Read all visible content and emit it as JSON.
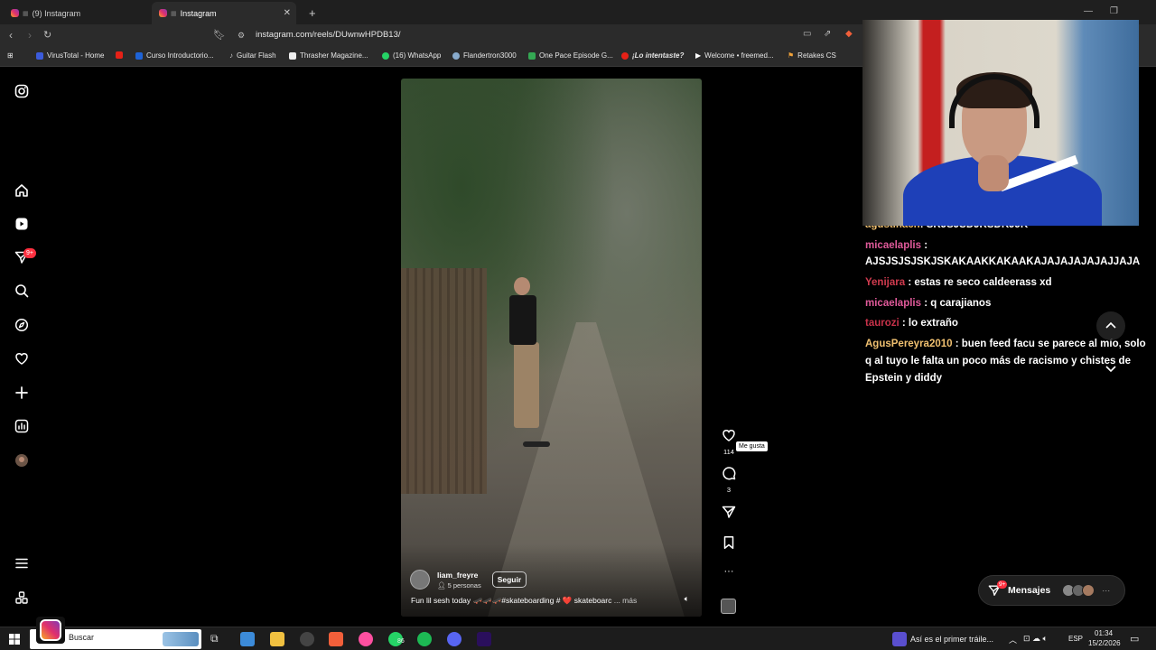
{
  "browser": {
    "tabs": [
      {
        "label": "(9) Instagram",
        "active": false
      },
      {
        "label": "Instagram",
        "active": true
      }
    ],
    "url": "instagram.com/reels/DUwnwHPDB13/",
    "bookmarks": [
      "VirusTotal - Home",
      "Curso Introductorio...",
      "Guitar Flash",
      "Thrasher Magazine...",
      "(16) WhatsApp",
      "Flandertron3000",
      "One Pace Episode G...",
      "¡Lo intentaste?",
      "Welcome • freemed...",
      "Retakes CS"
    ]
  },
  "sidebar": {
    "notifications_badge": "9+",
    "icons": [
      "instagram-logo-icon",
      "home-icon",
      "reels-icon",
      "messages-icon",
      "search-icon",
      "explore-icon",
      "heart-icon",
      "create-icon",
      "dashboard-icon",
      "profile-avatar",
      "menu-icon",
      "apps-icon"
    ]
  },
  "reel": {
    "username": "liam_freyre",
    "people": "5 personas",
    "follow_label": "Seguir",
    "caption": "Fun lil sesh today 🛹🛹🛹#skateboarding # ❤️ skateboarc",
    "more_label": "... más",
    "likes": "114",
    "comments": "3",
    "tooltip": "Me gusta"
  },
  "chat": {
    "messages": [
      {
        "user": "agustinach",
        "text": ": SKJSJSDJKSDKJJK",
        "color": "#ffffff"
      },
      {
        "user": "micaelaplis",
        "text": ":",
        "color": "#e05a9a"
      },
      {
        "user": "",
        "text": "AJSJSJSJSKJSKAKAAKKAKAAKAJAJAJAJAJAJJAJA",
        "color": "#ffffff"
      },
      {
        "user": "Yenijara",
        "text": ": estas re seco caldeerass xd",
        "color": "#d13b4f"
      },
      {
        "user": "micaelaplis",
        "text": ": q carajianos",
        "color": "#e05a9a"
      },
      {
        "user": "taurozi",
        "text": ": lo extraño",
        "color": "#c8324a"
      },
      {
        "user": "AgusPereyra2010",
        "text": ": buen feed facu se parece al mío, solo q al tuyo le falta un poco más de racismo y chistes de Epstein y diddy",
        "color": "#f0c070"
      }
    ]
  },
  "messages_pill": {
    "label": "Mensajes",
    "badge": "9+"
  },
  "taskbar": {
    "search_placeholder": "Buscar",
    "news": "Así es el primer tráile...",
    "whatsapp_badge": "86",
    "lang": "ESP",
    "time": "01:34",
    "date": "15/2/2026"
  }
}
